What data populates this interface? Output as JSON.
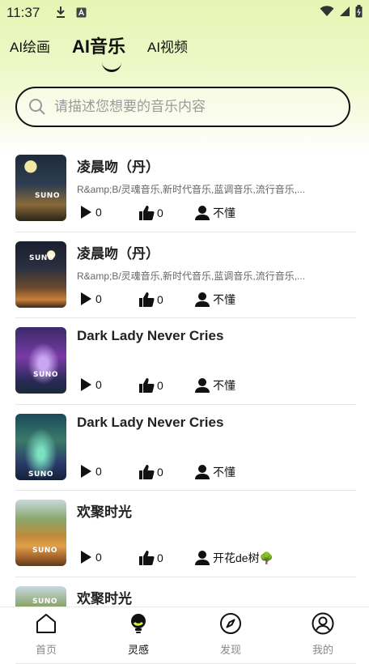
{
  "status_bar": {
    "time": "11:37"
  },
  "tabs": [
    {
      "label": "AI绘画"
    },
    {
      "label": "AI音乐"
    },
    {
      "label": "AI视频"
    }
  ],
  "search": {
    "placeholder": "请描述您想要的音乐内容"
  },
  "cover_badge": "SUNO",
  "songs": [
    {
      "title": "凌晨吻（丹）",
      "tags": "R&amp;B/灵魂音乐,新时代音乐,蓝调音乐,流行音乐,...",
      "plays": "0",
      "likes": "0",
      "author": "不懂"
    },
    {
      "title": "凌晨吻（丹）",
      "tags": "R&amp;B/灵魂音乐,新时代音乐,蓝调音乐,流行音乐,...",
      "plays": "0",
      "likes": "0",
      "author": "不懂"
    },
    {
      "title": "Dark Lady Never Cries",
      "tags": "",
      "plays": "0",
      "likes": "0",
      "author": "不懂"
    },
    {
      "title": "Dark Lady Never Cries",
      "tags": "",
      "plays": "0",
      "likes": "0",
      "author": "不懂"
    },
    {
      "title": "欢聚时光",
      "tags": "",
      "plays": "0",
      "likes": "0",
      "author": "开花de树🌳"
    },
    {
      "title": "欢聚时光",
      "tags": "",
      "plays": "",
      "likes": "",
      "author": ""
    }
  ],
  "bottom_nav": [
    {
      "label": "首页",
      "icon": "home-icon"
    },
    {
      "label": "灵感",
      "icon": "lightbulb-icon"
    },
    {
      "label": "发现",
      "icon": "compass-icon"
    },
    {
      "label": "我的",
      "icon": "user-circle-icon"
    }
  ],
  "colors": {
    "accent_bg": "#e6f5b3",
    "text": "#111111"
  }
}
